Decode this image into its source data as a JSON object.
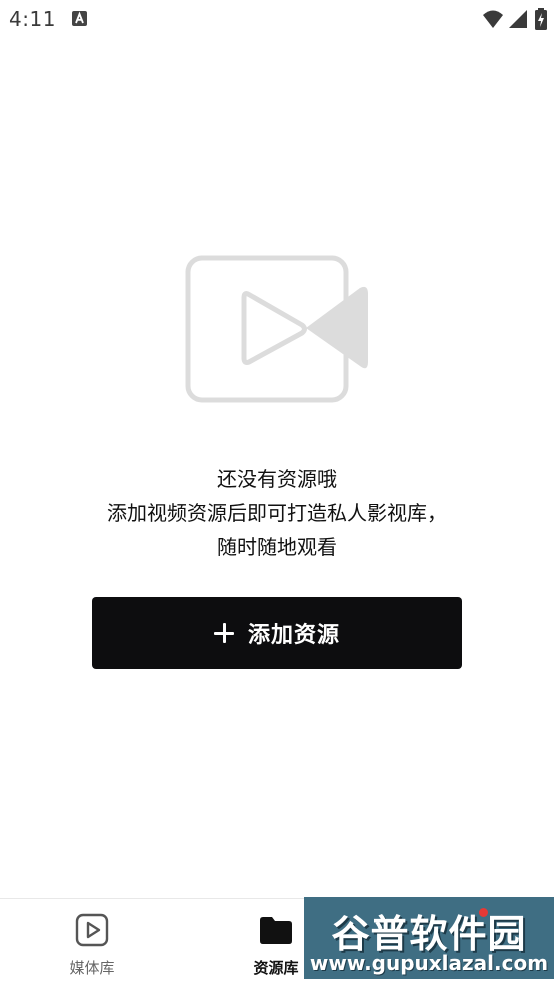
{
  "status_bar": {
    "time": "4:11",
    "app_icon": "a-square-icon",
    "icons": [
      "wifi-icon",
      "signal-icon",
      "battery-charging-icon"
    ]
  },
  "empty_state": {
    "icon": "video-camera-icon",
    "line1": "还没有资源哦",
    "line2": "添加视频资源后即可打造私人影视库，",
    "line3": "随时随地观看"
  },
  "add_button": {
    "icon": "plus-icon",
    "label": "添加资源"
  },
  "bottom_nav": {
    "tabs": [
      {
        "label": "媒体库",
        "icon": "play-square-icon",
        "active": false
      },
      {
        "label": "资源库",
        "icon": "folder-icon",
        "active": true
      }
    ]
  },
  "watermark": {
    "title": "谷普软件园",
    "url": "www.gupuxlazal.com"
  },
  "colors": {
    "button_bg": "#0d0d0f",
    "icon_gray": "#dcdcdc",
    "watermark_bg": "#3f6e83",
    "badge_red": "#e53935"
  }
}
